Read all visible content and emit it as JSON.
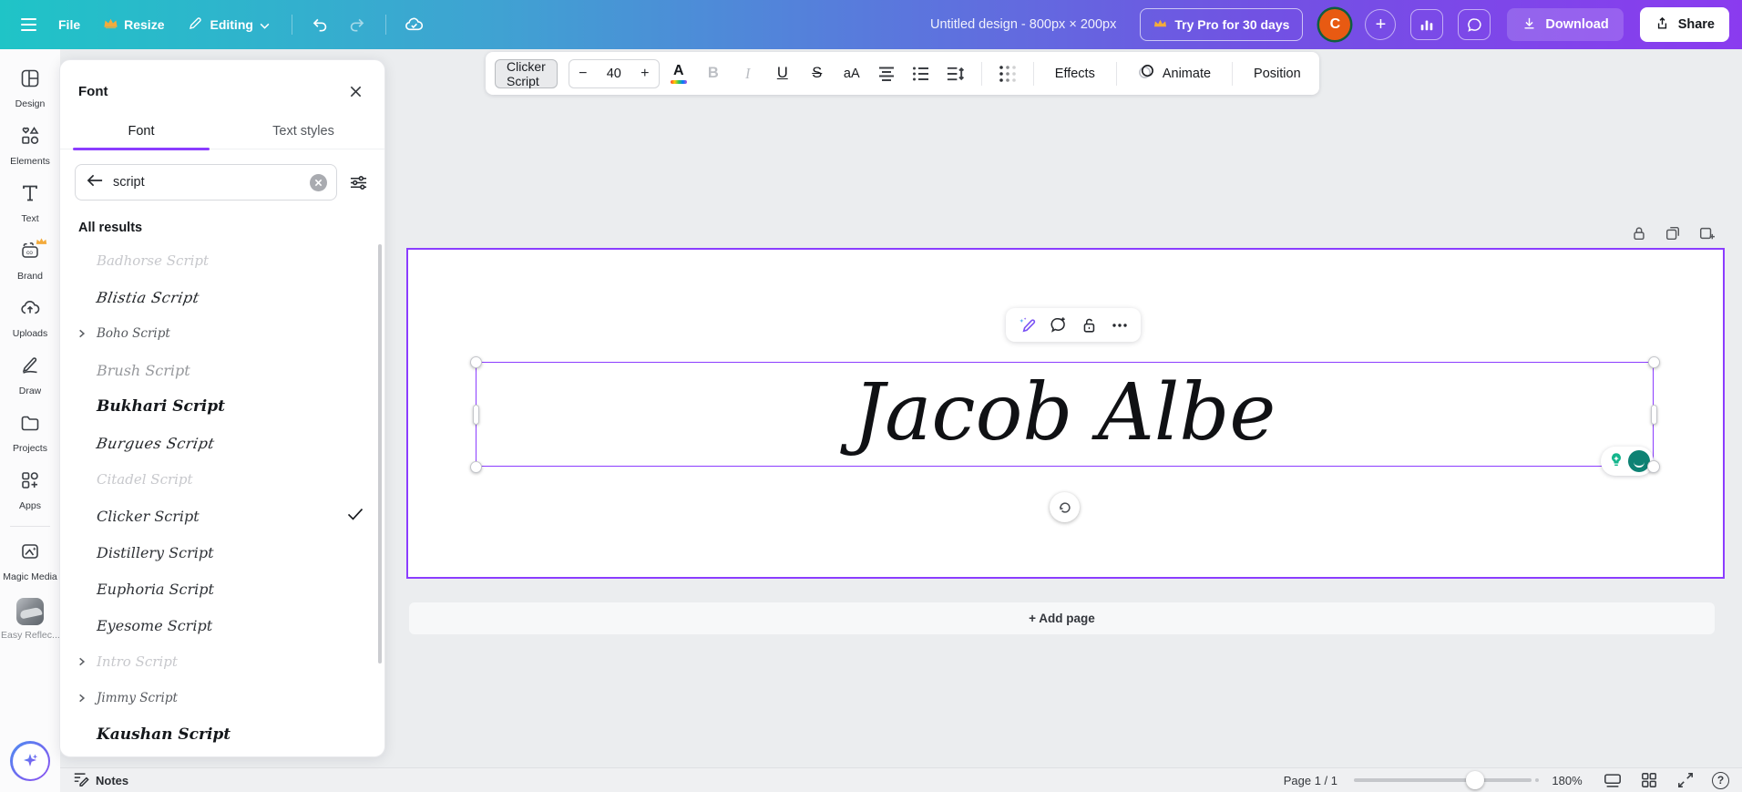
{
  "topbar": {
    "file": "File",
    "resize": "Resize",
    "editing": "Editing",
    "title": "Untitled design - 800px × 200px",
    "try_pro": "Try Pro for 30 days",
    "avatar_initial": "C",
    "add_label": "+",
    "download": "Download",
    "share": "Share"
  },
  "sidebar": {
    "items": [
      {
        "label": "Design"
      },
      {
        "label": "Elements"
      },
      {
        "label": "Text"
      },
      {
        "label": "Brand",
        "pro": true
      },
      {
        "label": "Uploads"
      },
      {
        "label": "Draw"
      },
      {
        "label": "Projects"
      },
      {
        "label": "Apps"
      },
      {
        "label": "Magic Media"
      },
      {
        "label": "Easy Reflec..."
      }
    ]
  },
  "font_panel": {
    "title": "Font",
    "tab_font": "Font",
    "tab_text_styles": "Text styles",
    "search_value": "script",
    "results_header": "All results",
    "fonts": [
      {
        "name": "Badhorse Script",
        "tone": "faint",
        "expandable": false,
        "selected": false
      },
      {
        "name": "Blistia Script",
        "tone": "ornate",
        "expandable": false,
        "selected": false
      },
      {
        "name": "Boho Script",
        "tone": "thin",
        "expandable": true,
        "selected": false
      },
      {
        "name": "Brush Script",
        "tone": "muted",
        "expandable": false,
        "selected": false
      },
      {
        "name": "Bukhari Script",
        "tone": "bold",
        "expandable": false,
        "selected": false
      },
      {
        "name": "Burgues Script",
        "tone": "ornate",
        "expandable": false,
        "selected": false
      },
      {
        "name": "Citadel Script",
        "tone": "faint",
        "expandable": false,
        "selected": false
      },
      {
        "name": "Clicker Script",
        "tone": "normal",
        "expandable": false,
        "selected": true
      },
      {
        "name": "Distillery Script",
        "tone": "normal",
        "expandable": false,
        "selected": false
      },
      {
        "name": "Euphoria Script",
        "tone": "normal",
        "expandable": false,
        "selected": false
      },
      {
        "name": "Eyesome Script",
        "tone": "normal",
        "expandable": false,
        "selected": false
      },
      {
        "name": "Intro Script",
        "tone": "faint",
        "expandable": true,
        "selected": false
      },
      {
        "name": "Jimmy Script",
        "tone": "thin",
        "expandable": true,
        "selected": false
      },
      {
        "name": "Kaushan Script",
        "tone": "bold",
        "expandable": false,
        "selected": false
      }
    ]
  },
  "editbar": {
    "font_name": "Clicker Script",
    "decrease": "−",
    "font_size": "40",
    "increase": "+",
    "color_label": "A",
    "bold": "B",
    "italic": "I",
    "underline": "U",
    "strikethrough": "S",
    "case_label": "aA",
    "effects": "Effects",
    "animate": "Animate",
    "position": "Position"
  },
  "canvas": {
    "text": "Jacob Albe",
    "add_page": "+ Add page"
  },
  "statusbar": {
    "notes": "Notes",
    "page_indicator": "Page 1 / 1",
    "zoom_level": "180%",
    "help": "?"
  },
  "colors": {
    "accent_purple": "#8b3dff",
    "topbar_gradient_start": "#1fc4c7",
    "topbar_gradient_end": "#8a3bef",
    "avatar_orange": "#e85a12",
    "crown_gold": "#f3ab3c",
    "assistant_teal": "#0e8274"
  }
}
